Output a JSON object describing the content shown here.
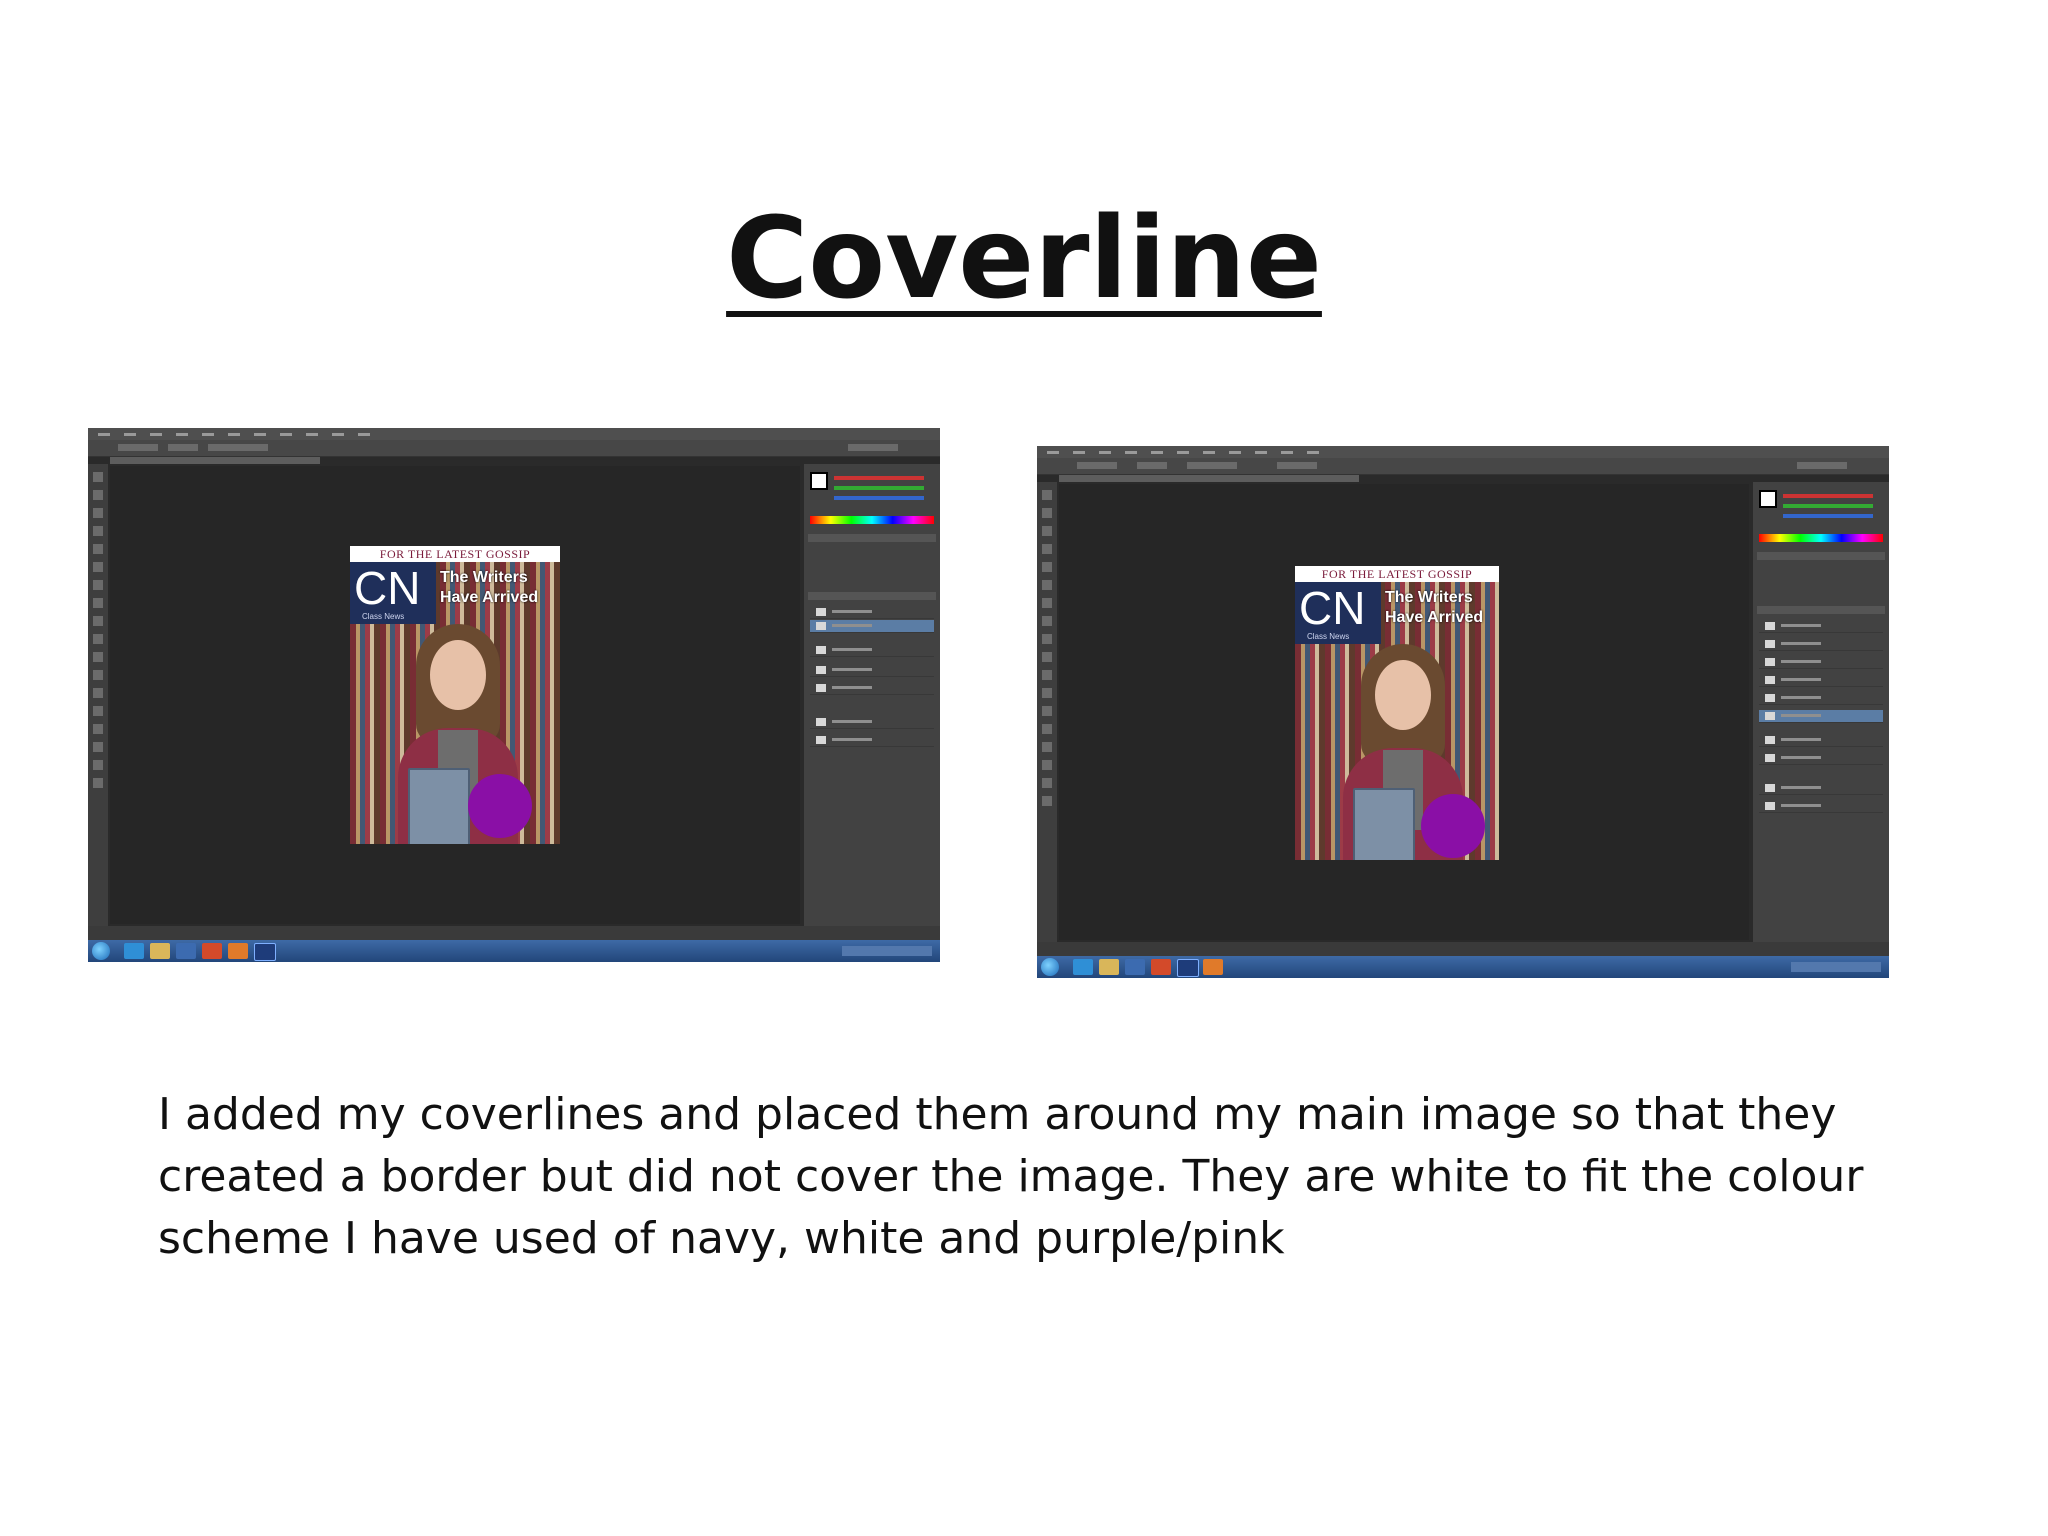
{
  "slide": {
    "title": "Coverline",
    "body_lines": [
      "I added my coverlines and placed them around my main image so that they",
      "created a border but did not cover the image. They are white to fit the colour",
      "scheme I have used of navy, white and purple/pink"
    ]
  },
  "screenshots": [
    {
      "app": "Photoshop",
      "cover": {
        "banner": "FOR THE LATEST GOSSIP",
        "masthead": "CN",
        "masthead_sub": "Class News",
        "headline": "The Writers Have Arrived"
      }
    },
    {
      "app": "Photoshop",
      "cover": {
        "banner": "FOR THE LATEST GOSSIP",
        "masthead": "CN",
        "masthead_sub": "Class News",
        "headline": "The Writers Have Arrived"
      }
    }
  ],
  "colors": {
    "navy": "#1f2f5a",
    "purple": "#8a0fa6",
    "photoshop_bg": "#2a2a2a",
    "taskbar": "#2b5490"
  }
}
